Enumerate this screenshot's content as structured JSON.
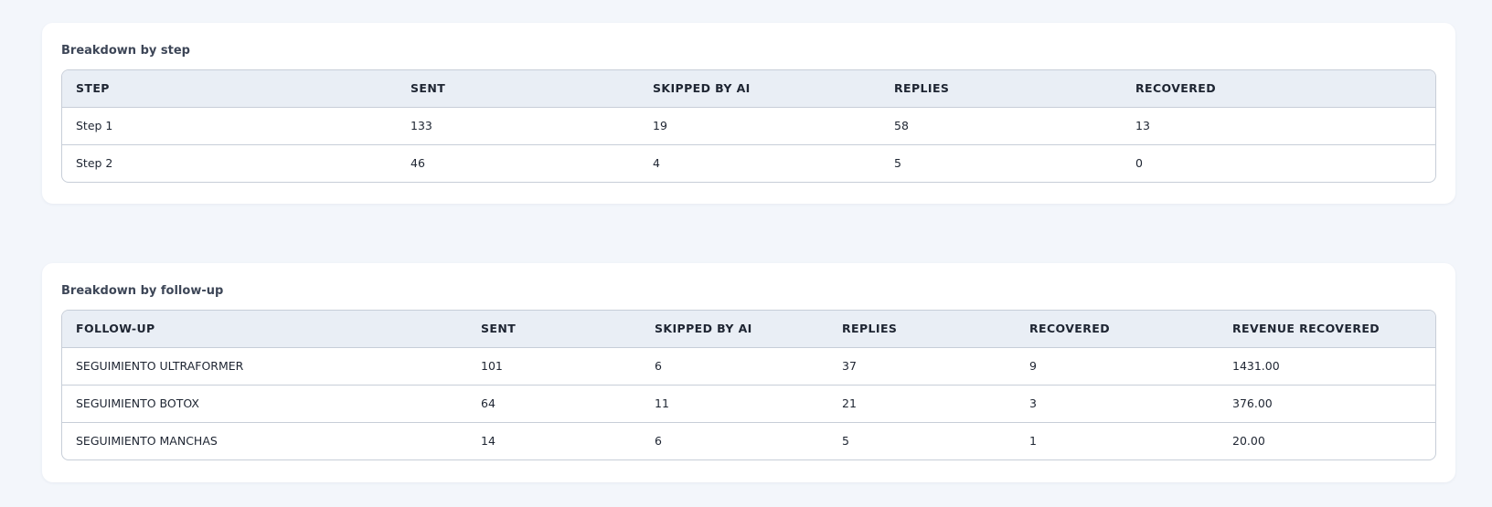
{
  "steps_section": {
    "title": "Breakdown by step",
    "headers": [
      "STEP",
      "SENT",
      "SKIPPED BY AI",
      "REPLIES",
      "RECOVERED"
    ],
    "rows": [
      [
        "Step 1",
        "133",
        "19",
        "58",
        "13"
      ],
      [
        "Step 2",
        "46",
        "4",
        "5",
        "0"
      ]
    ]
  },
  "followups_section": {
    "title": "Breakdown by follow-up",
    "headers": [
      "FOLLOW-UP",
      "SENT",
      "SKIPPED BY AI",
      "REPLIES",
      "RECOVERED",
      "REVENUE RECOVERED"
    ],
    "rows": [
      [
        "SEGUIMIENTO ULTRAFORMER",
        "101",
        "6",
        "37",
        "9",
        "1431.00"
      ],
      [
        "SEGUIMIENTO BOTOX",
        "64",
        "11",
        "21",
        "3",
        "376.00"
      ],
      [
        "SEGUIMIENTO MANCHAS",
        "14",
        "6",
        "5",
        "1",
        "20.00"
      ]
    ]
  }
}
